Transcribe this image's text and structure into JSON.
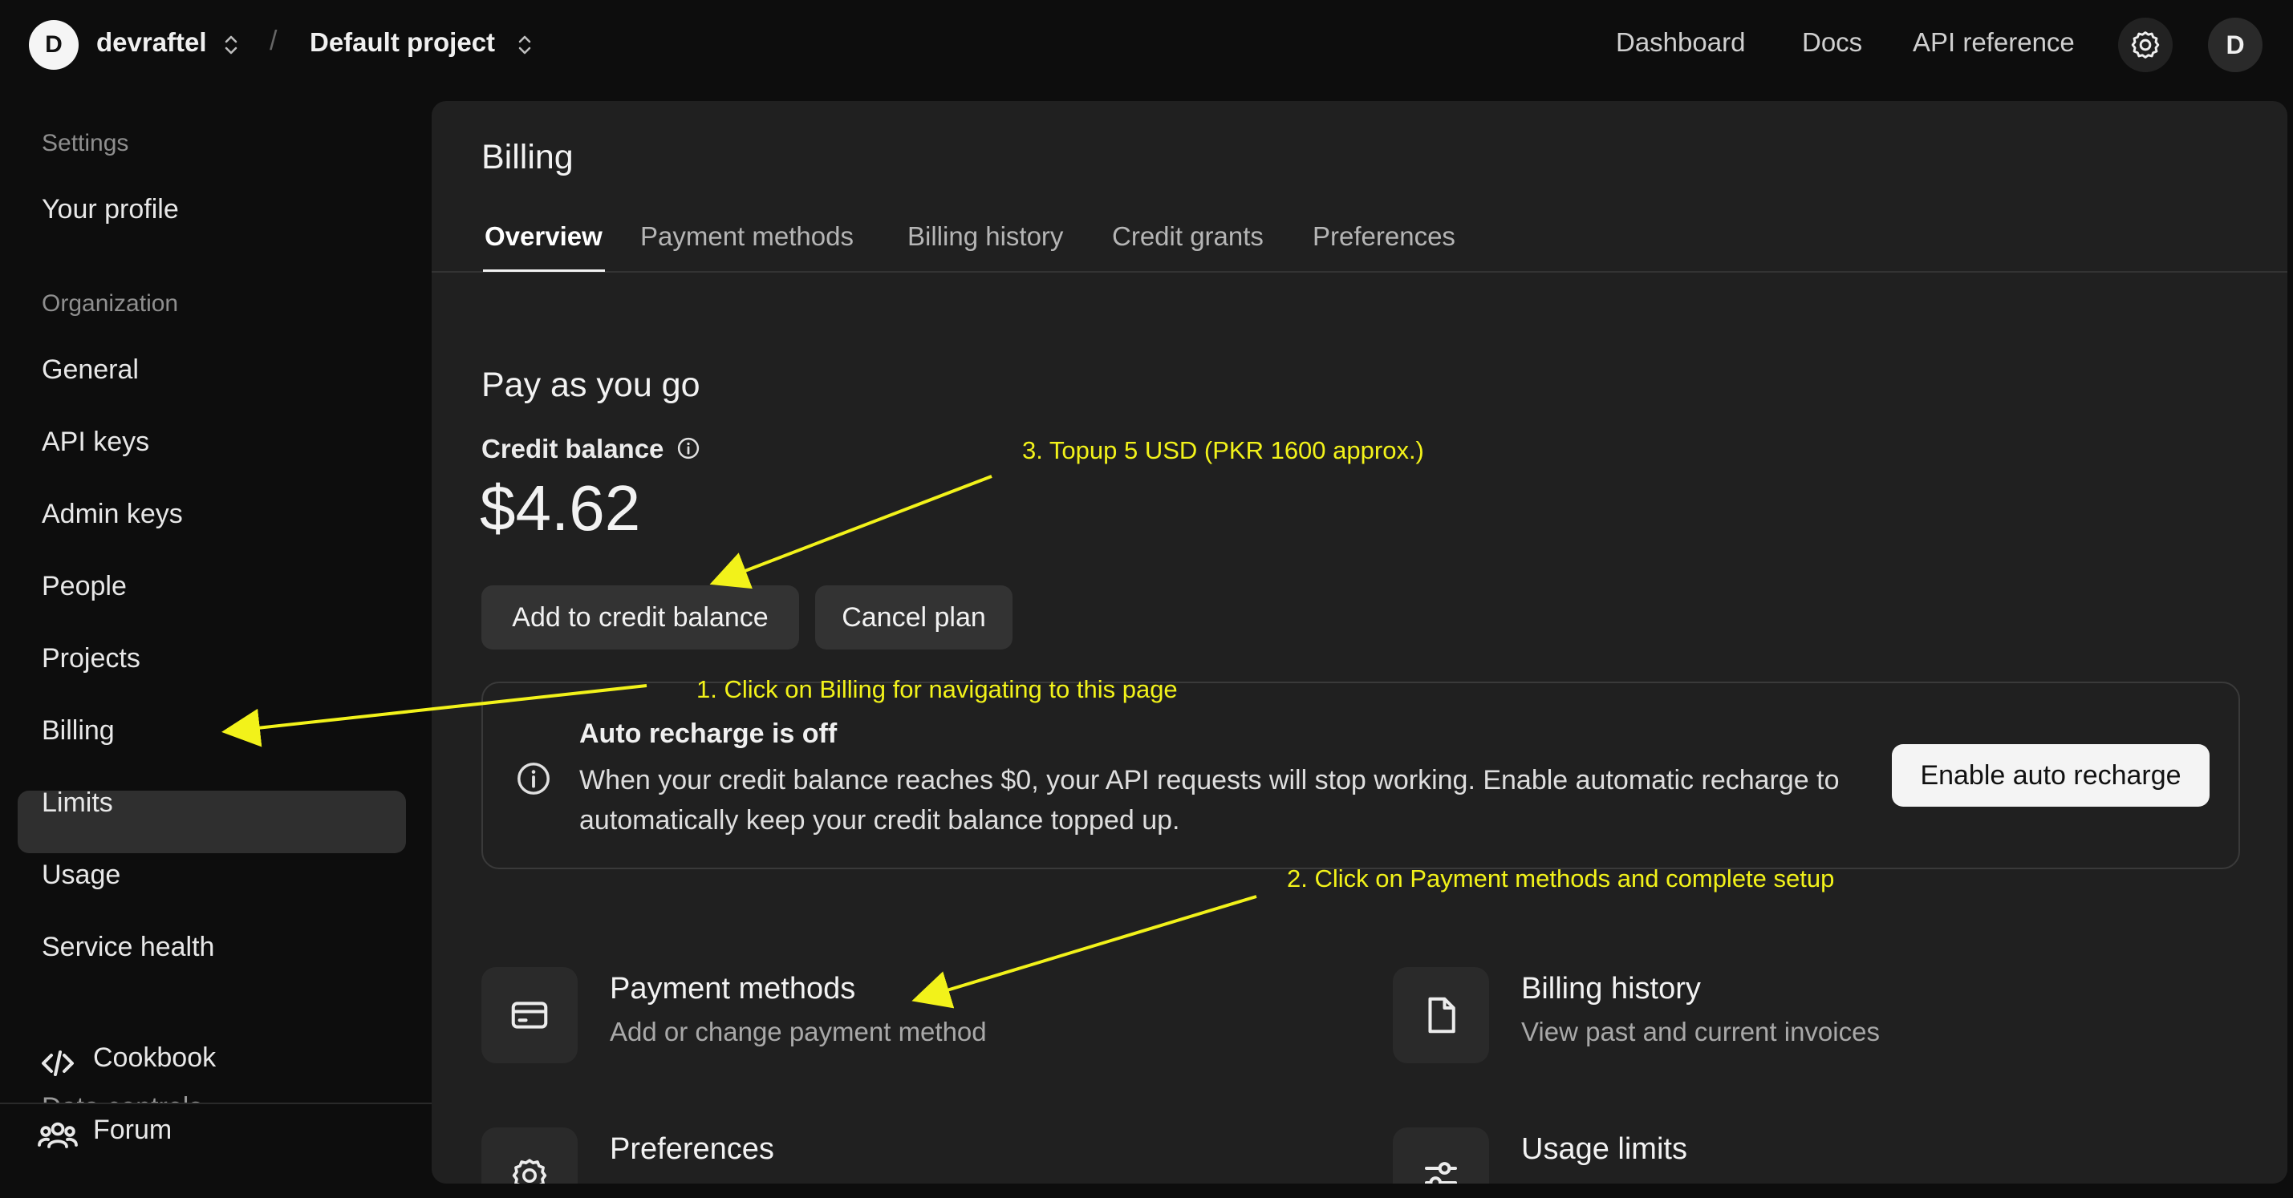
{
  "topbar": {
    "org_initial": "D",
    "org_name": "devraftel",
    "separator": "/",
    "project_name": "Default project",
    "nav": [
      "Dashboard",
      "Docs",
      "API reference"
    ],
    "settings_icon": "gear-icon",
    "user_initial": "D"
  },
  "sidebar": {
    "settings_heading": "Settings",
    "profile": "Your profile",
    "org_heading": "Organization",
    "items": [
      "General",
      "API keys",
      "Admin keys",
      "People",
      "Projects",
      "Billing",
      "Limits",
      "Usage",
      "Service health"
    ],
    "active_item": "Billing",
    "truncated_item": "Data controls",
    "footer": [
      {
        "label": "Cookbook",
        "icon": "code-icon"
      },
      {
        "label": "Forum",
        "icon": "people-icon"
      }
    ]
  },
  "main": {
    "title": "Billing",
    "tabs": [
      "Overview",
      "Payment methods",
      "Billing history",
      "Credit grants",
      "Preferences"
    ],
    "active_tab": "Overview",
    "plan_title": "Pay as you go",
    "credit_label": "Credit balance",
    "credit_amount": "$4.62",
    "add_credit_button": "Add to credit balance",
    "cancel_button": "Cancel plan",
    "notice": {
      "title": "Auto recharge is off",
      "text": "When your credit balance reaches $0, your API requests will stop working. Enable automatic recharge to automatically keep your credit balance topped up.",
      "button": "Enable auto recharge"
    },
    "cards": [
      {
        "title": "Payment methods",
        "subtitle": "Add or change payment method",
        "icon": "credit-card-icon"
      },
      {
        "title": "Billing history",
        "subtitle": "View past and current invoices",
        "icon": "document-icon"
      },
      {
        "title": "Preferences",
        "subtitle": "",
        "icon": "settings-icon"
      },
      {
        "title": "Usage limits",
        "subtitle": "",
        "icon": "sliders-icon"
      }
    ]
  },
  "annotations": {
    "step1": "1. Click on Billing for navigating to this page",
    "step2": "2. Click on Payment methods and complete setup",
    "step3": "3. Topup 5 USD (PKR 1600 approx.)",
    "color": "#f2f21a"
  }
}
